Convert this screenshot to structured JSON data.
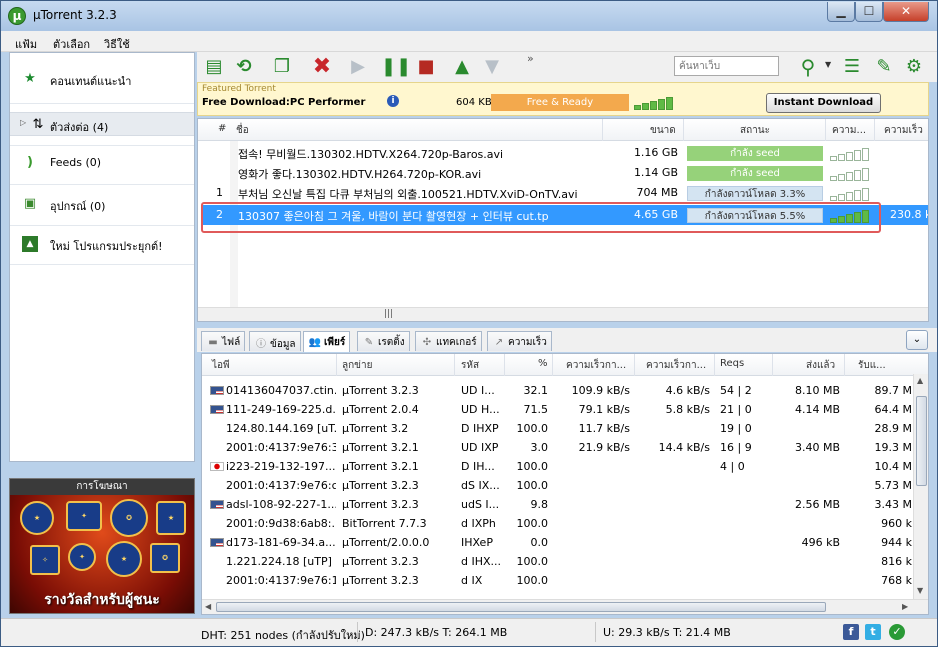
{
  "window": {
    "title": "µTorrent 3.2.3",
    "app_icon": "µ"
  },
  "menu": [
    "แฟ้ม",
    "ตัวเลือก",
    "วิธีใช้"
  ],
  "sidebar": {
    "items": [
      {
        "label": "คอนเทนต์แนะนำ",
        "icon": "star-icon",
        "glyph": "★",
        "color": "#1c8a2f"
      },
      {
        "label": "ตัวส่งต่อ (4)",
        "icon": "torrents-icon",
        "glyph": "⇅",
        "color": "#333"
      },
      {
        "label": "Feeds (0)",
        "icon": "rss-icon",
        "glyph": ")",
        "color": "#3a9a2e"
      },
      {
        "label": "อุปกรณ์ (0)",
        "icon": "device-icon",
        "glyph": "▣",
        "color": "#3a8a2e"
      },
      {
        "label": "ใหม่ โปรแกรมประยุกต์!",
        "icon": "apps-icon",
        "glyph": "▲",
        "color": "#2d7a2a"
      }
    ],
    "ad_label": "การโฆษณา",
    "ad_text": "รางวัลสำหรับผู้ชนะ"
  },
  "search": {
    "placeholder": "ค้นหาเว็บ"
  },
  "featured": {
    "label": "Featured Torrent",
    "title": "Free Download:PC Performer",
    "size": "604 KB",
    "status": "Free & Ready",
    "button": "Instant Download"
  },
  "torrent_columns": [
    "#",
    "ชื่อ",
    "ขนาด",
    "สถานะ",
    "ความ...",
    "ความเร็ว"
  ],
  "torrents": [
    {
      "num": "",
      "name": "접속! 무비월드.130302.HDTV.X264.720p-Baros.avi",
      "size": "1.16 GB",
      "status": "กำลัง seed",
      "kind": "seed",
      "avail": 0,
      "speed": ""
    },
    {
      "num": "",
      "name": "영화가 좋다.130302.HDTV.H264.720p-KOR.avi",
      "size": "1.14 GB",
      "status": "กำลัง seed",
      "kind": "seed",
      "avail": 0,
      "speed": ""
    },
    {
      "num": "1",
      "name": "부처님 오신날 특집 다큐 부처님의 외출.100521.HDTV.XviD-OnTV.avi",
      "size": "704 MB",
      "status": "กำลังดาวน์โหลด 3.3%",
      "kind": "dl",
      "avail": 0,
      "speed": ""
    },
    {
      "num": "2",
      "name": "130307 좋은아침 그 겨울, 바람이 분다 촬영현장 + 인터뷰 cut.tp",
      "size": "4.65 GB",
      "status": "กำลังดาวน์โหลด 5.5%",
      "kind": "dl",
      "avail": 5,
      "speed": "230.8 k"
    }
  ],
  "tabs": [
    {
      "label": "ไฟล์",
      "icon": "files-icon",
      "glyph": "▬"
    },
    {
      "label": "ข้อมูล",
      "icon": "info-icon",
      "glyph": "ⓘ"
    },
    {
      "label": "เพียร์",
      "icon": "peers-icon",
      "glyph": "👥"
    },
    {
      "label": "เรตติ้ง",
      "icon": "ratings-icon",
      "glyph": "✎"
    },
    {
      "label": "แทคเกอร์",
      "icon": "trackers-icon",
      "glyph": "✣"
    },
    {
      "label": "ความเร็ว",
      "icon": "speed-icon",
      "glyph": "↗"
    }
  ],
  "peer_columns": [
    "ไอพี",
    "ลูกข่าย",
    "รหัส",
    "%",
    "ความเร็วกา...",
    "ความเร็วกา...",
    "Reqs",
    "ส่งแล้ว",
    "รับแ..."
  ],
  "peers": [
    {
      "flag": "us",
      "ip": "014136047037.ctin...",
      "client": "µTorrent 3.2.3",
      "flags": "UD I...",
      "pct": "32.1",
      "down": "109.9 kB/s",
      "up": "4.6 kB/s",
      "reqs": "54 | 2",
      "sent": "8.10 MB",
      "recv": "89.7 M"
    },
    {
      "flag": "us",
      "ip": "111-249-169-225.d...",
      "client": "µTorrent 2.0.4",
      "flags": "UD H...",
      "pct": "71.5",
      "down": "79.1 kB/s",
      "up": "5.8 kB/s",
      "reqs": "21 | 0",
      "sent": "4.14 MB",
      "recv": "64.4 M"
    },
    {
      "flag": "",
      "ip": "124.80.144.169 [uT...",
      "client": "µTorrent 3.2",
      "flags": "D IHXP",
      "pct": "100.0",
      "down": "11.7 kB/s",
      "up": "",
      "reqs": "19 | 0",
      "sent": "",
      "recv": "28.9 M"
    },
    {
      "flag": "",
      "ip": "2001:0:4137:9e76:3...",
      "client": "µTorrent 3.2.1",
      "flags": "UD IXP",
      "pct": "3.0",
      "down": "21.9 kB/s",
      "up": "14.4 kB/s",
      "reqs": "16 | 9",
      "sent": "3.40 MB",
      "recv": "19.3 M"
    },
    {
      "flag": "jp",
      "ip": "i223-219-132-197....",
      "client": "µTorrent 3.2.1",
      "flags": "D IH...",
      "pct": "100.0",
      "down": "",
      "up": "",
      "reqs": "4 | 0",
      "sent": "",
      "recv": "10.4 M"
    },
    {
      "flag": "",
      "ip": "2001:0:4137:9e76:c...",
      "client": "µTorrent 3.2.3",
      "flags": "dS IX...",
      "pct": "100.0",
      "down": "",
      "up": "",
      "reqs": "",
      "sent": "",
      "recv": "5.73 M"
    },
    {
      "flag": "us",
      "ip": "adsl-108-92-227-1...",
      "client": "µTorrent 3.2.3",
      "flags": "udS I...",
      "pct": "9.8",
      "down": "",
      "up": "",
      "reqs": "",
      "sent": "2.56 MB",
      "recv": "3.43 M"
    },
    {
      "flag": "",
      "ip": "2001:0:9d38:6ab8:...",
      "client": "BitTorrent 7.7.3",
      "flags": "d IXPh",
      "pct": "100.0",
      "down": "",
      "up": "",
      "reqs": "",
      "sent": "",
      "recv": "960 k"
    },
    {
      "flag": "us",
      "ip": "d173-181-69-34.a...",
      "client": "µTorrent/2.0.0.0",
      "flags": "IHXeP",
      "pct": "0.0",
      "down": "",
      "up": "",
      "reqs": "",
      "sent": "496 kB",
      "recv": "944 k"
    },
    {
      "flag": "",
      "ip": "1.221.224.18 [uTP]",
      "client": "µTorrent 3.2.3",
      "flags": "d IHX...",
      "pct": "100.0",
      "down": "",
      "up": "",
      "reqs": "",
      "sent": "",
      "recv": "816 k"
    },
    {
      "flag": "",
      "ip": "2001:0:4137:9e76:1...",
      "client": "µTorrent 3.2.3",
      "flags": "d IX",
      "pct": "100.0",
      "down": "",
      "up": "",
      "reqs": "",
      "sent": "",
      "recv": "768 k"
    }
  ],
  "status": {
    "dht": "DHT: 251 nodes (กำลังปรับใหม่)",
    "download": "D: 247.3 kB/s T: 264.1 MB",
    "upload": "U: 29.3 kB/s T: 21.4 MB"
  }
}
